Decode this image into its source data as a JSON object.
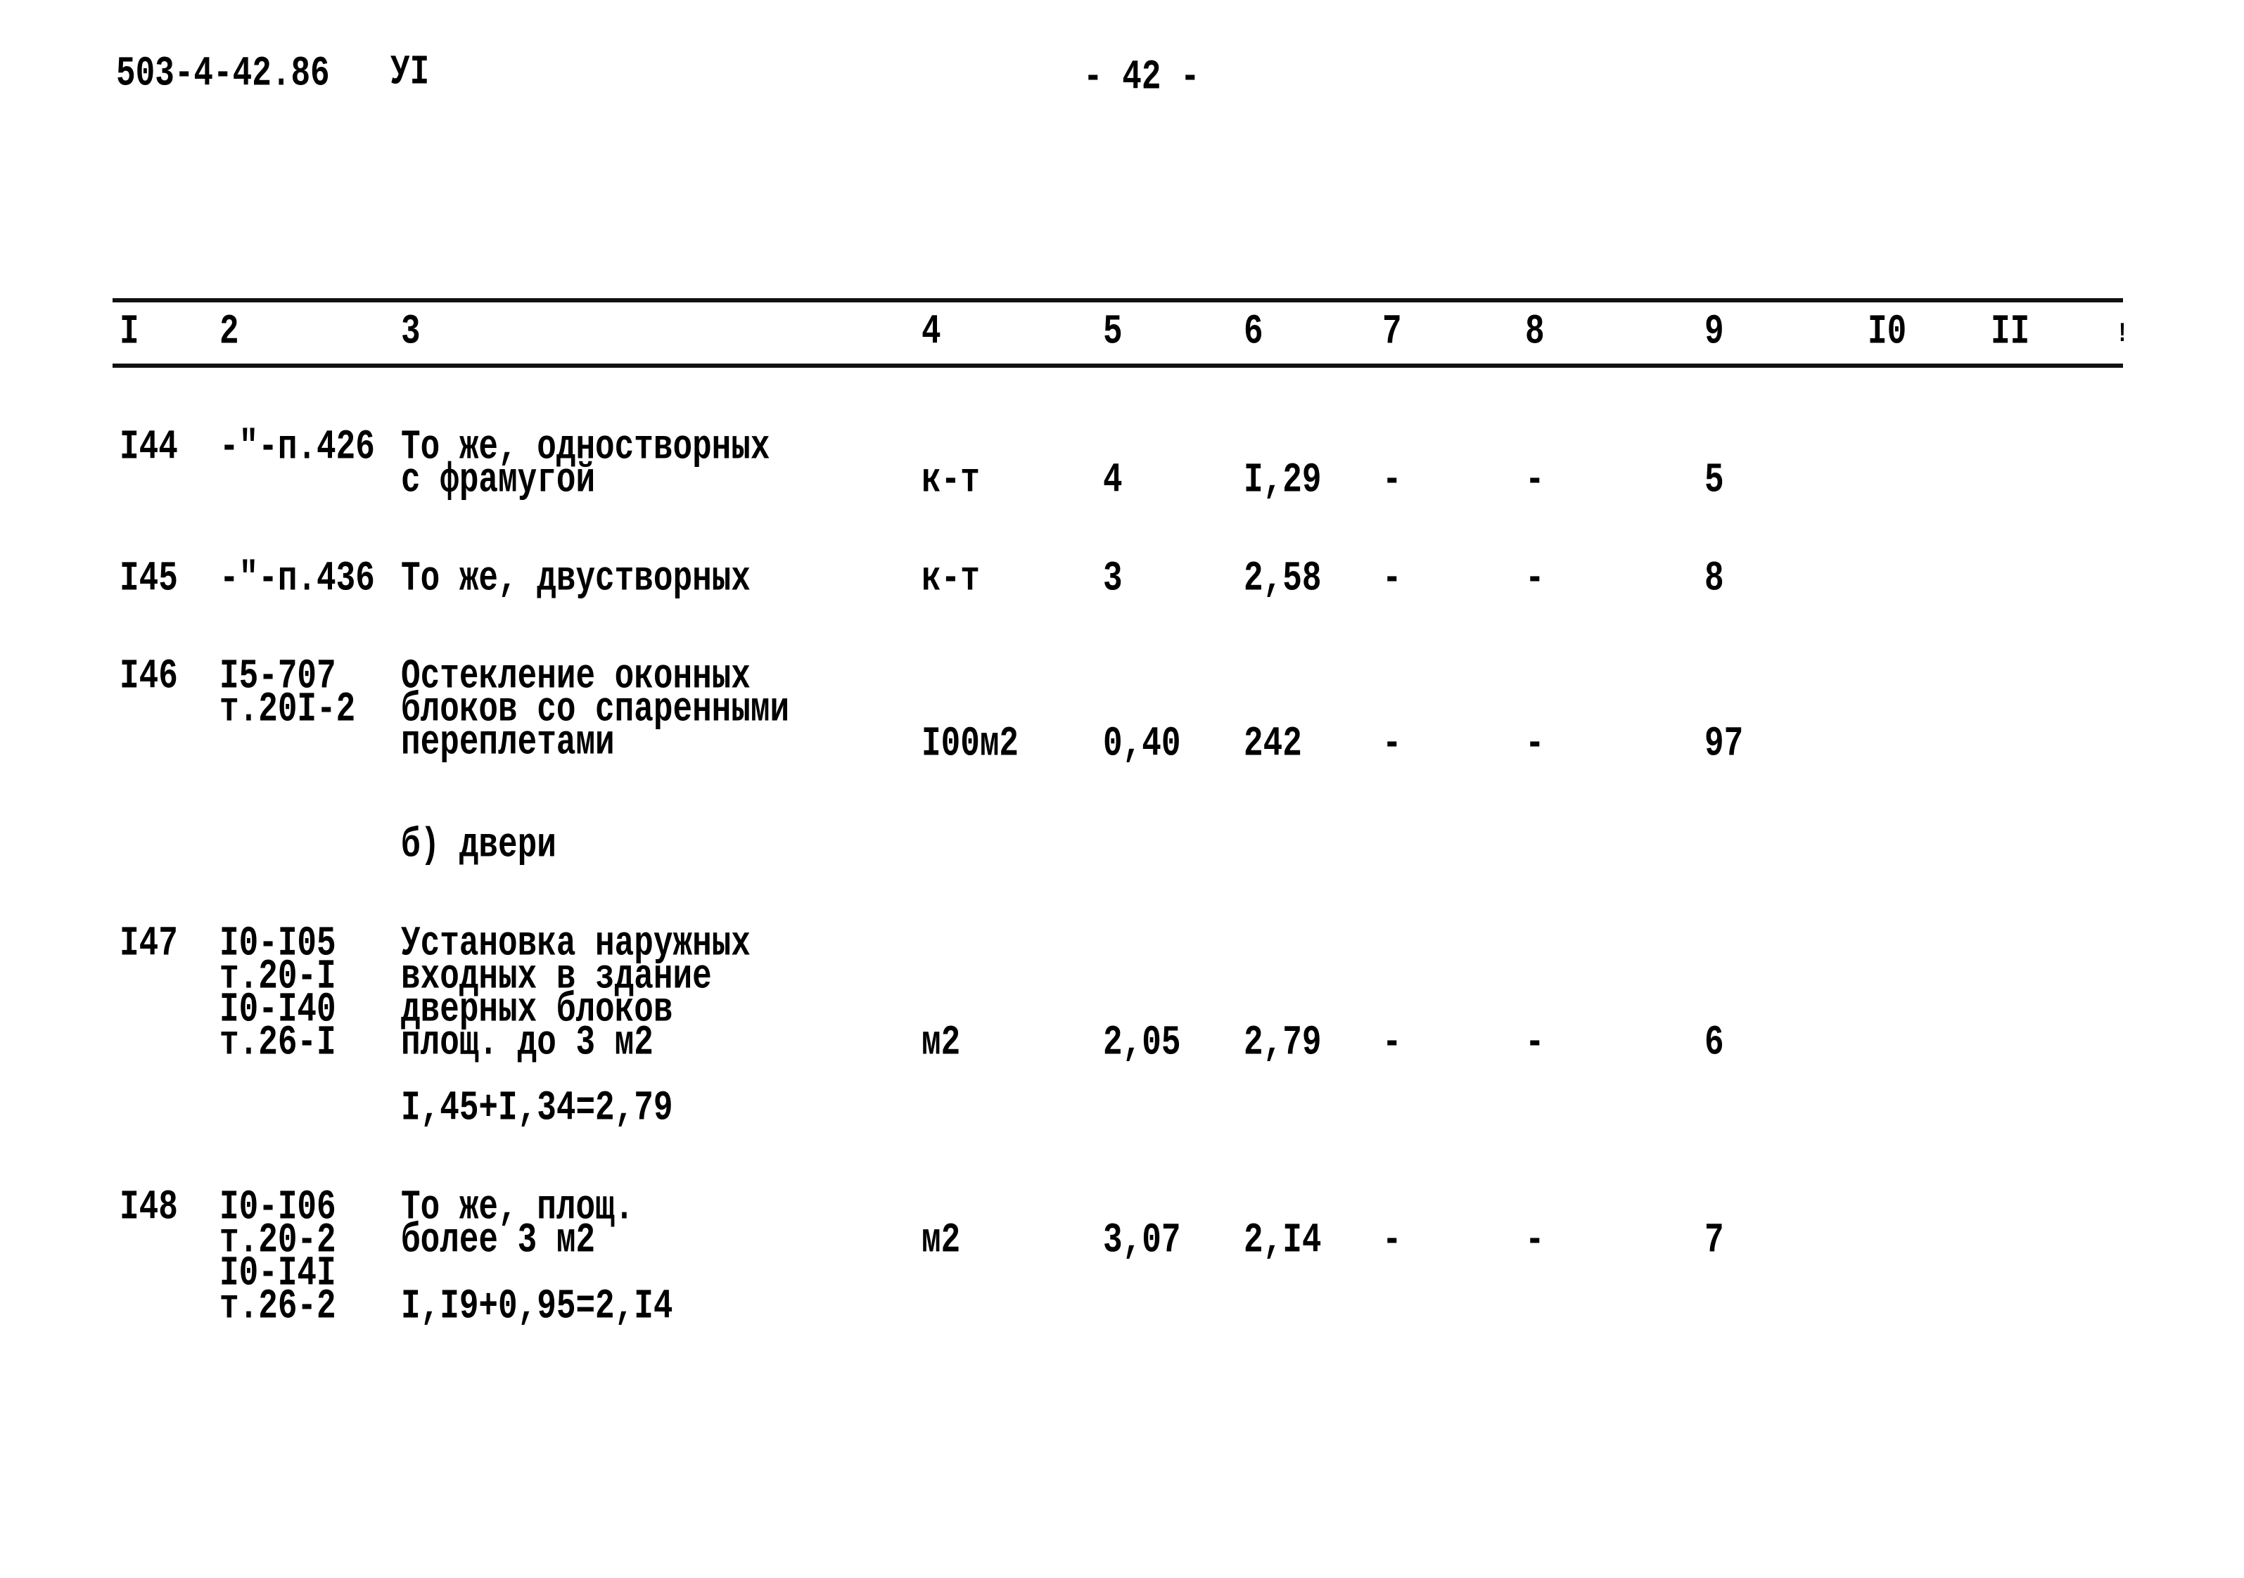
{
  "page_header": {
    "doc_code": "503-4-42.86",
    "section": "УI",
    "page_number": "- 42 -"
  },
  "table": {
    "column_numbers": [
      "I",
      "2",
      "3",
      "4",
      "5",
      "6",
      "7",
      "8",
      "9",
      "I0",
      "II",
      "!"
    ],
    "rows": [
      {
        "num": "I44",
        "ref": [
          "-\"-п.426"
        ],
        "desc": [
          "То же, одностворных",
          "с фрамугой"
        ],
        "unit": "к-т",
        "qty": "4",
        "price": "I,29",
        "col7": "-",
        "col8": "-",
        "col9": "5"
      },
      {
        "num": "I45",
        "ref": [
          "-\"-п.436"
        ],
        "desc": [
          "То же, двустворных"
        ],
        "unit": "к-т",
        "qty": "3",
        "price": "2,58",
        "col7": "-",
        "col8": "-",
        "col9": "8"
      },
      {
        "num": "I46",
        "ref": [
          "I5-707",
          "т.20I-2"
        ],
        "desc": [
          "Остекление оконных",
          "блоков со спаренными",
          "переплетами"
        ],
        "unit": "I00м2",
        "qty": "0,40",
        "price": "242",
        "col7": "-",
        "col8": "-",
        "col9": "97"
      },
      {
        "num": "I47",
        "ref": [
          "I0-I05",
          "т.20-I",
          "I0-I40",
          "т.26-I"
        ],
        "desc": [
          "Установка наружных",
          "входных в здание",
          "дверных блоков",
          "площ. до 3 м2"
        ],
        "formula": "I,45+I,34=2,79",
        "unit": "м2",
        "qty": "2,05",
        "price": "2,79",
        "col7": "-",
        "col8": "-",
        "col9": "6"
      },
      {
        "num": "I48",
        "ref": [
          "I0-I06",
          "т.20-2",
          "I0-I4I",
          "т.26-2"
        ],
        "desc": [
          "То же, площ.",
          "более 3 м2"
        ],
        "formula": "I,I9+0,95=2,I4",
        "unit": "м2",
        "qty": "3,07",
        "price": "2,I4",
        "col7": "-",
        "col8": "-",
        "col9": "7"
      }
    ],
    "subsection_label": "б) двери"
  }
}
